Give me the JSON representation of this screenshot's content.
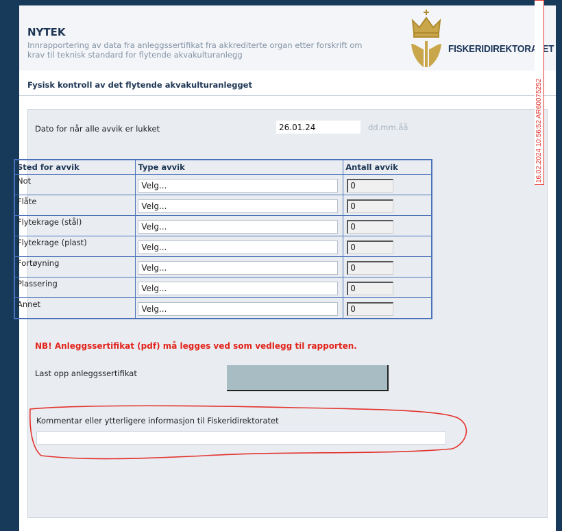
{
  "header": {
    "title": "NYTEK",
    "subtitle_line1": "Innrapportering av data fra anleggssertifikat fra akkrediterte organ etter forskrift om",
    "subtitle_line2": "krav til teknisk standard for flytende akvakulturanlegg",
    "logo_text": "FISKERIDIREKTORATET"
  },
  "stamp": {
    "text": "16.02.2024 10:56:52 AR60075252"
  },
  "section": {
    "title": "Fysisk kontroll av det flytende akvakulturanlegget"
  },
  "date": {
    "label": "Dato for når alle avvik er lukket",
    "value": "26.01.24",
    "hint": "dd.mm.åå"
  },
  "table": {
    "headers": [
      "Sted for avvik",
      "Type avvik",
      "Antall avvik"
    ],
    "rows": [
      {
        "place": "Not",
        "type": "Velg...",
        "count": "0"
      },
      {
        "place": "Flåte",
        "type": "Velg...",
        "count": "0"
      },
      {
        "place": "Flytekrage (stål)",
        "type": "Velg...",
        "count": "0"
      },
      {
        "place": "Flytekrage (plast)",
        "type": "Velg...",
        "count": "0"
      },
      {
        "place": "Fortøyning",
        "type": "Velg...",
        "count": "0"
      },
      {
        "place": "Plassering",
        "type": "Velg...",
        "count": "0"
      },
      {
        "place": "Annet",
        "type": "Velg...",
        "count": "0"
      }
    ]
  },
  "warning": "NB! Anleggssertifikat (pdf) må legges ved som vedlegg til rapporten.",
  "upload": {
    "label": "Last opp anleggssertifikat"
  },
  "comment": {
    "label": "Kommentar eller ytterligere informasjon til Fiskeridirektoratet",
    "value": ""
  },
  "colors": {
    "background": "#173a5b",
    "heading": "#1d3553",
    "table_border": "#4b72b8",
    "warning": "#e2231a",
    "annotation": "#e3322c"
  }
}
